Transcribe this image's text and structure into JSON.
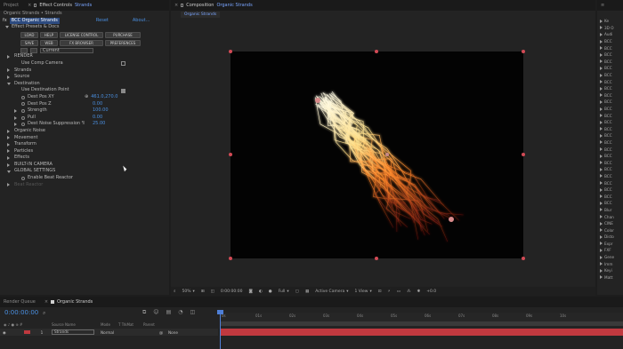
{
  "project_tab": "Project",
  "effect_controls_tab": "Effect Controls",
  "effect_controls_layer": "Strands",
  "comp_tab": "Composition",
  "comp_name": "Organic Strands",
  "comp_subtab": "Organic Strands",
  "ec_header": "Organic Strands • Strands",
  "ec_effect_name": "BCC Organic Strands",
  "ec_reset": "Reset",
  "ec_about": "About...",
  "presets_label": "Effect Presets & Docs",
  "preset_buttons": [
    {
      "label": "LOAD"
    },
    {
      "label": "HELP"
    },
    {
      "label": "LICENSE CONTROL"
    },
    {
      "label": "PURCHASE"
    },
    {
      "label": "SAVE"
    },
    {
      "label": "WEB"
    },
    {
      "label": "FX BROWSER"
    },
    {
      "label": "PREFERENCES"
    }
  ],
  "preset_value": "Current",
  "props": [
    {
      "label": "RENDER",
      "indent": 0,
      "tri": "closed"
    },
    {
      "label": "Use Comp Camera",
      "indent": 1,
      "checkbox": "off"
    },
    {
      "label": "Strands",
      "indent": 0,
      "tri": "closed"
    },
    {
      "label": "Source",
      "indent": 0,
      "tri": "closed"
    },
    {
      "label": "Destination",
      "indent": 0,
      "tri": "open"
    },
    {
      "label": "Use Destination Point",
      "indent": 1,
      "checkbox": "on"
    },
    {
      "label": "Dest Pos XY",
      "indent": 1,
      "stopwatch": true,
      "value": "461.0,270.0",
      "target": true
    },
    {
      "label": "Dest Pos Z",
      "indent": 1,
      "stopwatch": true,
      "value": "0.00"
    },
    {
      "label": "Strength",
      "indent": 1,
      "tri": "closed",
      "stopwatch": true,
      "value": "100.00"
    },
    {
      "label": "Pull",
      "indent": 1,
      "tri": "closed",
      "stopwatch": true,
      "value": "0.00"
    },
    {
      "label": "Dest Noise Suppression %",
      "indent": 1,
      "tri": "closed",
      "stopwatch": true,
      "value": "25.00"
    },
    {
      "label": "Organic Noise",
      "indent": 0,
      "tri": "closed"
    },
    {
      "label": "Movement",
      "indent": 0,
      "tri": "closed"
    },
    {
      "label": "Transform",
      "indent": 0,
      "tri": "closed"
    },
    {
      "label": "Particles",
      "indent": 0,
      "tri": "closed"
    },
    {
      "label": "Effects",
      "indent": 0,
      "tri": "closed"
    },
    {
      "label": "BUILT-IN CAMERA",
      "indent": 0,
      "tri": "closed"
    },
    {
      "label": "GLOBAL SETTINGS",
      "indent": 0,
      "tri": "open"
    },
    {
      "label": "Enable Beat Reactor",
      "indent": 1,
      "stopwatch": true
    },
    {
      "label": "Beat Reactor",
      "indent": 0,
      "tri": "closed",
      "dim": true
    }
  ],
  "effects_list": [
    "Ke",
    "3D O",
    "Audi",
    "BCC",
    "BCC",
    "BCC",
    "BCC",
    "BCC",
    "BCC",
    "BCC",
    "BCC",
    "BCC",
    "BCC",
    "BCC",
    "BCC",
    "BCC",
    "BCC",
    "BCC",
    "BCC",
    "BCC",
    "BCC",
    "BCC",
    "BCC",
    "BCC",
    "BCC",
    "BCC",
    "BCC",
    "BCC",
    "Blur",
    "Chan",
    "CINE",
    "Color",
    "Disto",
    "Expr",
    "FXF",
    "Gene",
    "Imm",
    "Keyi",
    "Matt"
  ],
  "viewer": {
    "zoom": "50%",
    "timecode": "0:00:00:00",
    "resolution": "Full",
    "camera": "Active Camera",
    "views": "1 View",
    "exposure": "+0.0"
  },
  "timeline": {
    "render_queue_tab": "Render Queue",
    "comp_tab": "Organic Strands",
    "timecode": "0:00:00:00",
    "col_layer_name": "Source Name",
    "col_mode": "Mode",
    "col_trkmat": "T  TrkMat",
    "col_parent": "Parent",
    "layer_index": "1",
    "layer_name": "Strands",
    "layer_mode": "Normal",
    "layer_parent": "None",
    "ruler": [
      "0s",
      "01s",
      "02s",
      "03s",
      "04s",
      "05s",
      "06s",
      "07s",
      "08s",
      "09s",
      "10s"
    ]
  },
  "colors": {
    "accent_blue": "#4a8fe0",
    "timeline_bar": "#c0393f",
    "playhead": "#4f7fd6"
  }
}
